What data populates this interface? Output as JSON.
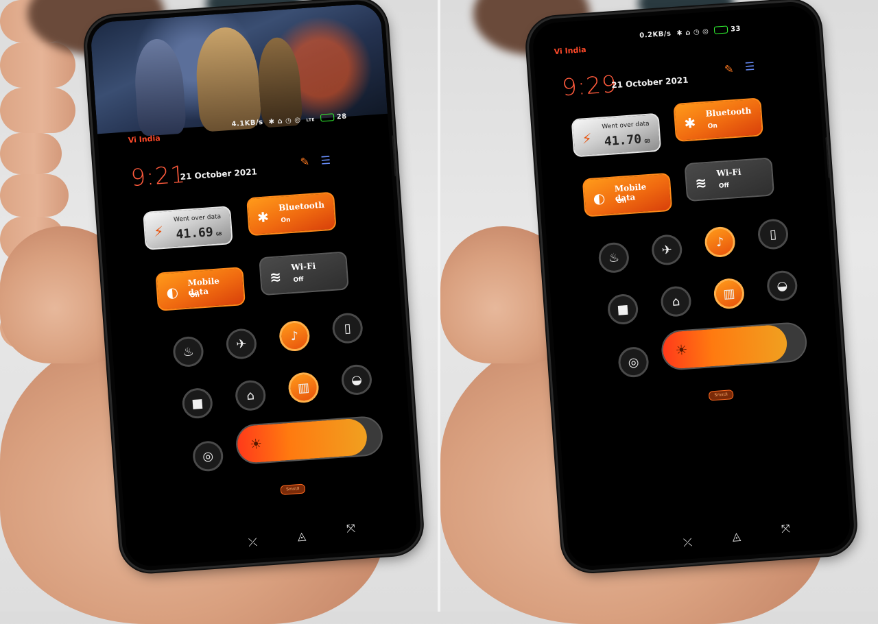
{
  "panels": [
    {
      "carrier": "Vi India",
      "status_speed": "4.1KB/s",
      "status_icons": "✱ ⌂ ◷ ◎",
      "network": "LTE",
      "battery": "28",
      "time": "9:21",
      "date": "21 October 2021",
      "data_tile": {
        "title": "Went over data",
        "value": "41.69",
        "unit": "GB"
      },
      "bluetooth": {
        "title": "Bluetooth",
        "status": "On"
      },
      "mobile_data": {
        "title": "Mobile data",
        "status": "On"
      },
      "wifi": {
        "title": "Wi-Fi",
        "status": "Off"
      },
      "badge": "SmxUI",
      "brightness": 0.9
    },
    {
      "carrier": "Vi India",
      "status_speed": "0.2KB/s",
      "status_icons": "✱ ⌂ ◷ ◎",
      "network": "",
      "battery": "33",
      "time": "9:29",
      "date": "21 October 2021",
      "data_tile": {
        "title": "Went over data",
        "value": "41.70",
        "unit": "GB"
      },
      "bluetooth": {
        "title": "Bluetooth",
        "status": "On"
      },
      "mobile_data": {
        "title": "Mobile data",
        "status": "On"
      },
      "wifi": {
        "title": "Wi-Fi",
        "status": "Off"
      },
      "badge": "SmxUI",
      "brightness": 0.87
    }
  ],
  "icons": {
    "header_left": "edit-icon",
    "header_right": "toggle-layout-icon",
    "round_row1": [
      "torch-icon",
      "airplane-icon",
      "bell-icon",
      "vibrate-icon"
    ],
    "round_row2": [
      "screen-record-icon",
      "screenshot-icon",
      "reading-mode-icon",
      "lock-icon"
    ],
    "brightness_button": "auto-brightness-icon",
    "nav": [
      "back-icon",
      "home-icon",
      "recents-icon"
    ]
  },
  "colors": {
    "accent": "#ff7a10",
    "time": "#ff5a3c",
    "carrier": "#ff4a2a"
  }
}
